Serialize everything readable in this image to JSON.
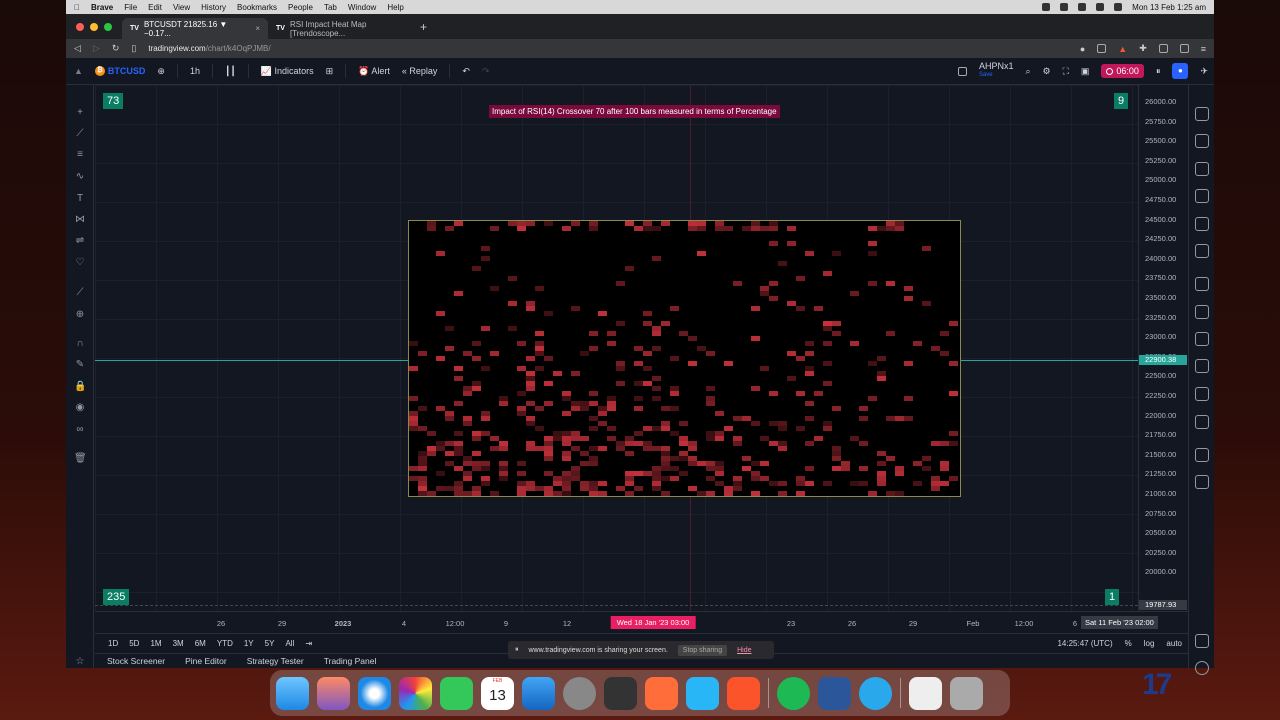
{
  "menubar": {
    "app": "Brave",
    "items": [
      "File",
      "Edit",
      "View",
      "History",
      "Bookmarks",
      "People",
      "Tab",
      "Window",
      "Help"
    ],
    "clock": "Mon 13 Feb  1:25 am"
  },
  "browser": {
    "tabs": [
      {
        "label": "BTCUSDT 21825.16 ▼ −0.17...",
        "favicon": "TV"
      },
      {
        "label": "RSI Impact Heat Map [Trendoscope...",
        "favicon": "TV"
      }
    ],
    "url_host": "tradingview.com",
    "url_path": "/chart/k4OqPJMB/"
  },
  "tv_toolbar": {
    "symbol": "BTCUSD",
    "interval": "1h",
    "indicators": "Indicators",
    "alert": "Alert",
    "replay": "Replay",
    "account": "AHPNx1",
    "account_sub": "Save",
    "timer": "06:00"
  },
  "chart": {
    "title": "Impact of RSI(14) Crossover 70 after 100 bars measured in terms of Percentage",
    "corner_tl": "73",
    "corner_tr": "9",
    "corner_bl": "235",
    "corner_br": "1",
    "price_ticks": [
      "26000.00",
      "25750.00",
      "25500.00",
      "25250.00",
      "25000.00",
      "24750.00",
      "24500.00",
      "24250.00",
      "24000.00",
      "23750.00",
      "23500.00",
      "23250.00",
      "23000.00",
      "22750.00",
      "22500.00",
      "22250.00",
      "22000.00",
      "21750.00",
      "21500.00",
      "21250.00",
      "21000.00",
      "20750.00",
      "20500.00",
      "20250.00",
      "20000.00"
    ],
    "current_price": "22900.38",
    "cross_price": "19787.93",
    "time_ticks": [
      {
        "label": "26",
        "bold": false
      },
      {
        "label": "29",
        "bold": false
      },
      {
        "label": "2023",
        "bold": true
      },
      {
        "label": "4",
        "bold": false
      },
      {
        "label": "12:00",
        "bold": false
      },
      {
        "label": "9",
        "bold": false
      },
      {
        "label": "12",
        "bold": false
      },
      {
        "label": "23",
        "bold": false
      },
      {
        "label": "26",
        "bold": false
      },
      {
        "label": "29",
        "bold": false
      },
      {
        "label": "Feb",
        "bold": false
      },
      {
        "label": "12:00",
        "bold": false
      },
      {
        "label": "6",
        "bold": false
      }
    ],
    "cross_time": "Wed 18 Jan '23  03:00",
    "cross_time_right": "Sat 11 Feb '23  02:00",
    "heat_color": "#e53945"
  },
  "range_bar": {
    "ranges": [
      "1D",
      "5D",
      "1M",
      "3M",
      "6M",
      "YTD",
      "1Y",
      "5Y",
      "All"
    ],
    "clock": "14:25:47 (UTC)",
    "pct": "%",
    "log": "log",
    "auto": "auto"
  },
  "bottom_tabs": [
    "Stock Screener",
    "Pine Editor",
    "Strategy Tester",
    "Trading Panel"
  ],
  "share_notice": {
    "text": "www.tradingview.com is sharing your screen.",
    "stop": "Stop sharing",
    "hide": "Hide"
  },
  "dock": {
    "calendar_month": "FEB",
    "calendar_day": "13"
  },
  "colors": {
    "accent": "#2962ff",
    "green": "#26a69a",
    "crosshair_label": "#e91e63"
  }
}
